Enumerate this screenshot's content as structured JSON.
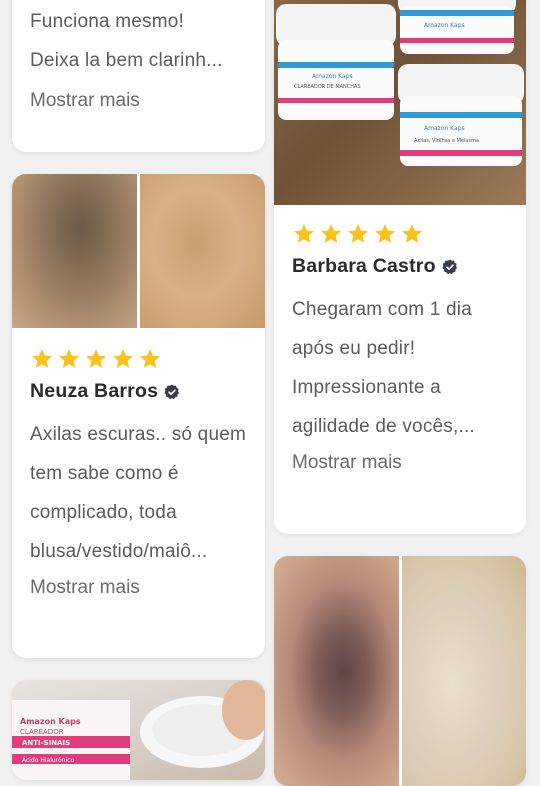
{
  "reviews": [
    {
      "text": "Funciona mesmo!\nDeixa la bem clarinh...",
      "more": "Mostrar mais"
    },
    {
      "name": "Barbara Castro",
      "rating": 5,
      "text": "Chegaram com 1 dia após eu pedir! Impressionante a agilidade de vocês,...",
      "more": "Mostrar mais"
    },
    {
      "name": "Neuza Barros",
      "rating": 5,
      "text": "Axilas escuras.. só quem tem sabe como é complicado, toda blusa/vestido/maiô...",
      "more": "Mostrar mais"
    }
  ],
  "product_label": {
    "brand": "Amazon Kaps",
    "line1": "CLAREADOR",
    "line2": "ANTI-SINAIS",
    "line3": "Ácido Hialurônico",
    "jar_text": "CLAREADOR DE MANCHAS",
    "jar_sub": "Axilas, Virilhas e Melasma"
  },
  "colors": {
    "star": "#f9c21c",
    "verified": "#3a3f47",
    "accent_pink": "#e23c7a",
    "accent_blue": "#2f7fc4"
  }
}
